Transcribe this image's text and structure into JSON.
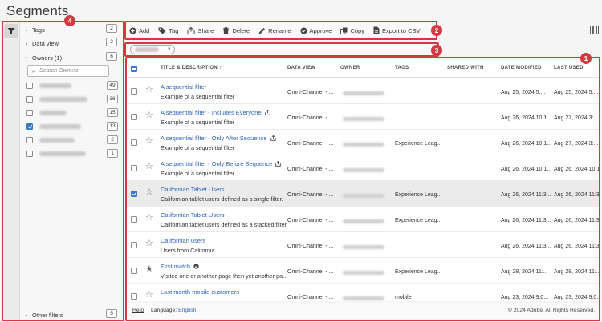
{
  "page": {
    "title": "Segments"
  },
  "filters": {
    "sections": [
      {
        "label": "Tags",
        "count": "2",
        "expanded": false
      },
      {
        "label": "Data view",
        "count": "2",
        "expanded": false
      },
      {
        "label": "Owners (1)",
        "count": "6",
        "expanded": true
      }
    ],
    "search_placeholder": "Search Owners",
    "owners": [
      {
        "count": "49",
        "checked": false
      },
      {
        "count": "36",
        "checked": false
      },
      {
        "count": "15",
        "checked": false
      },
      {
        "count": "13",
        "checked": true
      },
      {
        "count": "2",
        "checked": false
      },
      {
        "count": "1",
        "checked": false
      }
    ],
    "other": {
      "label": "Other filters",
      "count": "5"
    }
  },
  "toolbar": {
    "add": "Add",
    "tag": "Tag",
    "share": "Share",
    "delete": "Delete",
    "rename": "Rename",
    "approve": "Approve",
    "copy": "Copy",
    "export": "Export to CSV"
  },
  "table": {
    "columns": {
      "title": "TITLE & DESCRIPTION",
      "data_view": "DATA VIEW",
      "owner": "OWNER",
      "tags": "TAGS",
      "shared_with": "SHARED WITH",
      "date_modified": "DATE MODIFIED",
      "last_used": "LAST USED"
    },
    "rows": [
      {
        "title": "A sequential filter",
        "desc": "Example of a sequential filter",
        "data_view": "Omni-Channel - ...",
        "tags": "",
        "modified": "Aug 25, 2024 5:...",
        "last_used": "Aug 25, 2024 5:...",
        "shared": false,
        "approved": false,
        "starred": false,
        "selected": false
      },
      {
        "title": "A sequential filter - Includes Everyone",
        "desc": "Example of a sequential filter",
        "data_view": "Omni-Channel - ...",
        "tags": "",
        "modified": "Aug 26, 2024 10:1...",
        "last_used": "Aug 27, 2024 3:...",
        "shared": true,
        "approved": false,
        "starred": false,
        "selected": false
      },
      {
        "title": "A sequential filter - Only After Sequence",
        "desc": "Example of a sequential filter",
        "data_view": "Omni-Channel - ...",
        "tags": "Experience Leag...",
        "modified": "Aug 26, 2024 10:1...",
        "last_used": "Aug 27, 2024 3:...",
        "shared": true,
        "approved": false,
        "starred": false,
        "selected": false
      },
      {
        "title": "A sequential filter - Only Before Sequence",
        "desc": "Example of a sequential filter",
        "data_view": "Omni-Channel - ...",
        "tags": "",
        "modified": "Aug 26, 2024 10:1...",
        "last_used": "Aug 26, 2024 10:1...",
        "shared": true,
        "approved": false,
        "starred": false,
        "selected": false
      },
      {
        "title": "Californian Tablet Users",
        "desc": "Californian tablet users defined as a single filter.",
        "data_view": "Omni-Channel - ...",
        "tags": "Experience Leag...",
        "modified": "Aug 26, 2024 11:3...",
        "last_used": "Aug 26, 2024 11:3...",
        "shared": false,
        "approved": false,
        "starred": false,
        "selected": true
      },
      {
        "title": "Californian Tablet Users",
        "desc": "Californian tablet users defined as a stacked filter.",
        "data_view": "Omni-Channel - ...",
        "tags": "Experience Leag...",
        "modified": "Aug 26, 2024 11:3...",
        "last_used": "Aug 26, 2024 11:3...",
        "shared": false,
        "approved": false,
        "starred": false,
        "selected": false
      },
      {
        "title": "Californian users",
        "desc": "Users from California",
        "data_view": "Omni-Channel - ...",
        "tags": "",
        "modified": "Aug 26, 2024 11:3...",
        "last_used": "Aug 26, 2024 11:3...",
        "shared": false,
        "approved": false,
        "starred": false,
        "selected": false
      },
      {
        "title": "First match",
        "desc": "Visited one or another page then yet another pa...",
        "data_view": "Omni-Channel - ...",
        "tags": "Experience Leag...",
        "modified": "Aug 28, 2024 11:...",
        "last_used": "Aug 28, 2024 11:...",
        "shared": false,
        "approved": true,
        "starred": true,
        "selected": false
      },
      {
        "title": "Last month mobile customers",
        "desc": "",
        "data_view": "Omni-Channel - ...",
        "tags": "mobile",
        "modified": "Aug 23, 2024 9:0...",
        "last_used": "Aug 23, 2024 9:0...",
        "shared": false,
        "approved": false,
        "starred": false,
        "selected": false
      }
    ]
  },
  "footer": {
    "help": "Help",
    "language_label": "Language:",
    "language": "English",
    "copyright": "© 2024 Adobe. All Rights Reserved."
  },
  "callouts": [
    "1",
    "2",
    "3",
    "4"
  ],
  "colors": {
    "accent": "#2f63c0",
    "callout": "#d7373f",
    "checkbox": "#3a78c9"
  }
}
